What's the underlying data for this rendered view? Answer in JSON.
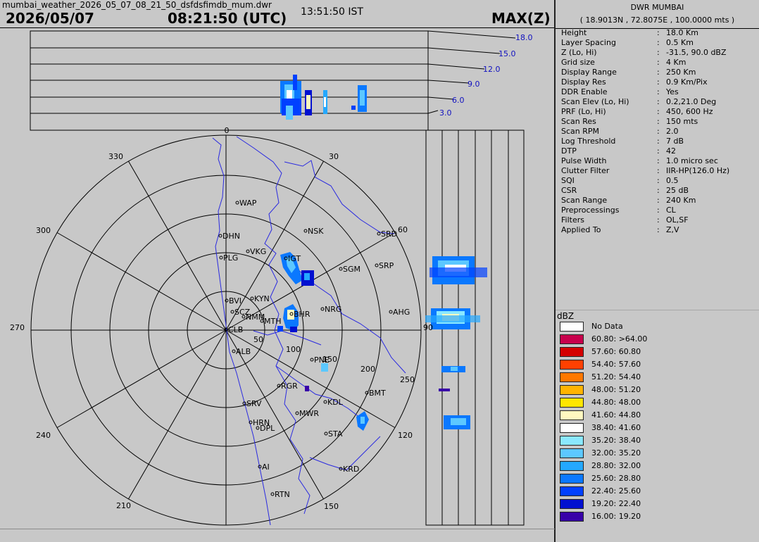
{
  "header": {
    "file_title": "mumbai_weather_2026_05_07_08_21_50_dsfdsfimdb_mum.dwr",
    "date": "2026/05/07",
    "time_utc": "08:21:50 (UTC)",
    "time_ist": "13:51:50 IST",
    "product": "MAX(Z)"
  },
  "sidebar": {
    "station": "DWR MUMBAI",
    "coords": "( 18.9013N , 72.8075E , 100.0000 mts )",
    "params": [
      {
        "key": "Height",
        "value": "18.0 Km"
      },
      {
        "key": "Layer Spacing",
        "value": "0.5 Km"
      },
      {
        "key": "Z (Lo, Hi)",
        "value": "-31.5, 90.0 dBZ"
      },
      {
        "key": "Grid size",
        "value": "4 Km"
      },
      {
        "key": "Display Range",
        "value": "250 Km"
      },
      {
        "key": "Display Res",
        "value": "0.9 Km/Pix"
      },
      {
        "key": "DDR Enable",
        "value": "Yes"
      },
      {
        "key": "Scan Elev (Lo, Hi)",
        "value": "0.2,21.0 Deg"
      },
      {
        "key": "PRF (Lo, Hi)",
        "value": "450, 600 Hz"
      },
      {
        "key": "Scan Res",
        "value": "150 mts"
      },
      {
        "key": "Scan RPM",
        "value": "2.0"
      },
      {
        "key": "Log Threshold",
        "value": "7 dB"
      },
      {
        "key": "DTP",
        "value": "42"
      },
      {
        "key": "Pulse Width",
        "value": "1.0 micro sec"
      },
      {
        "key": "Clutter Filter",
        "value": "IIR-HP(126.0 Hz)"
      },
      {
        "key": "SQI",
        "value": "0.5"
      },
      {
        "key": "CSR",
        "value": "25 dB"
      },
      {
        "key": "Scan Range",
        "value": "240 Km"
      },
      {
        "key": "Preprocessings",
        "value": "CL"
      },
      {
        "key": "Filters",
        "value": "OL,SF"
      },
      {
        "key": "Applied To",
        "value": "Z,V"
      }
    ]
  },
  "legend": {
    "title": "dBZ",
    "entries": [
      {
        "label": "No Data",
        "color": "#ffffff"
      },
      {
        "label": "60.80: >64.00",
        "color": "#c8004c"
      },
      {
        "label": "57.60: 60.80",
        "color": "#d40000"
      },
      {
        "label": "54.40: 57.60",
        "color": "#ff4000"
      },
      {
        "label": "51.20: 54.40",
        "color": "#ff7800"
      },
      {
        "label": "48.00: 51.20",
        "color": "#ffb400"
      },
      {
        "label": "44.80: 48.00",
        "color": "#ffe600"
      },
      {
        "label": "41.60: 44.80",
        "color": "#fff8c0"
      },
      {
        "label": "38.40: 41.60",
        "color": "#ffffff"
      },
      {
        "label": "35.20: 38.40",
        "color": "#8ae8ff"
      },
      {
        "label": "32.00: 35.20",
        "color": "#5cc8ff"
      },
      {
        "label": "28.80: 32.00",
        "color": "#24a8ff"
      },
      {
        "label": "25.60: 28.80",
        "color": "#0a78ff"
      },
      {
        "label": "22.40: 25.60",
        "color": "#0040ff"
      },
      {
        "label": "19.20: 22.40",
        "color": "#0010d0"
      },
      {
        "label": "16.00: 19.20",
        "color": "#3800a8"
      }
    ]
  },
  "radar": {
    "bearing_labels": [
      "0",
      "30",
      "60",
      "90",
      "120",
      "150",
      "210",
      "240",
      "270",
      "300",
      "330"
    ],
    "range_labels": [
      "50",
      "100",
      "150",
      "200",
      "250"
    ],
    "height_labels": [
      "3.0",
      "6.0",
      "9.0",
      "12.0",
      "15.0",
      "18.0"
    ],
    "stations": [
      "WAP",
      "NSK",
      "DHN",
      "SRD",
      "VKG",
      "IGT",
      "PLG",
      "SGM",
      "SRP",
      "KYN",
      "BVI",
      "AHG",
      "NRG",
      "SCZ",
      "BHR",
      "NMM",
      "MTH",
      "CLB",
      "ALB",
      "PNE",
      "RGR",
      "BMT",
      "SRV",
      "KDL",
      "MWR",
      "HRN",
      "DPL",
      "STA",
      "AI",
      "KRD",
      "RTN"
    ]
  }
}
